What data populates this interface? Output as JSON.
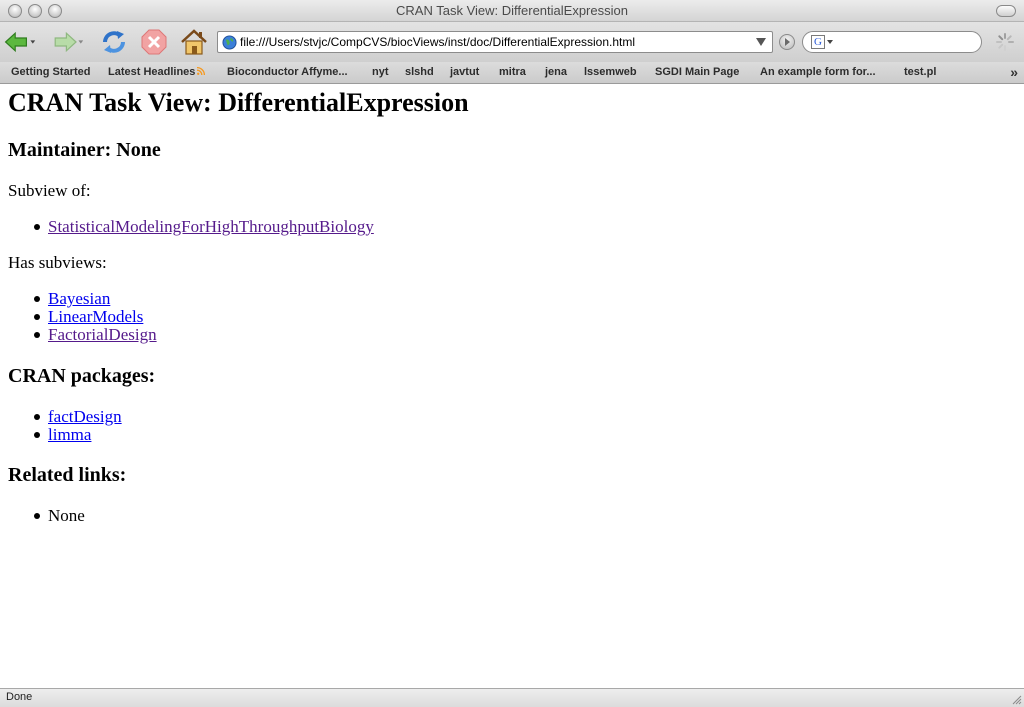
{
  "window": {
    "title": "CRAN Task View: DifferentialExpression"
  },
  "toolbar": {
    "url": "file:///Users/stvjc/CompCVS/biocViews/inst/doc/DifferentialExpression.html",
    "search_placeholder": "",
    "search_engine_letter": "G"
  },
  "bookmarks": [
    {
      "label": "Getting Started"
    },
    {
      "label": "Latest Headlines"
    },
    {
      "label": "Bioconductor Affyme..."
    },
    {
      "label": "nyt"
    },
    {
      "label": "slshd"
    },
    {
      "label": "javtut"
    },
    {
      "label": "mitra"
    },
    {
      "label": "jena"
    },
    {
      "label": "lssemweb"
    },
    {
      "label": "SGDI Main Page"
    },
    {
      "label": "An example form for..."
    },
    {
      "label": "test.pl"
    }
  ],
  "bookmarks_more": "»",
  "page": {
    "title": "CRAN Task View: DifferentialExpression",
    "maintainer": "Maintainer: None",
    "subview_of_label": "Subview of:",
    "subview_of": [
      {
        "text": "StatisticalModelingForHighThroughputBiology",
        "visited": true
      }
    ],
    "has_subviews_label": "Has subviews:",
    "has_subviews": [
      {
        "text": "Bayesian",
        "visited": false
      },
      {
        "text": "LinearModels",
        "visited": false
      },
      {
        "text": "FactorialDesign",
        "visited": true
      }
    ],
    "cran_packages_heading": "CRAN packages:",
    "cran_packages": [
      {
        "text": "factDesign"
      },
      {
        "text": "limma"
      }
    ],
    "related_links_heading": "Related links:",
    "related_links": [
      {
        "text": "None"
      }
    ]
  },
  "status": {
    "text": "Done"
  },
  "colors": {
    "link": "#0000ee",
    "visited_link": "#551a8b",
    "rss": "#f59a23",
    "back_arrow": "#3fa02f"
  }
}
